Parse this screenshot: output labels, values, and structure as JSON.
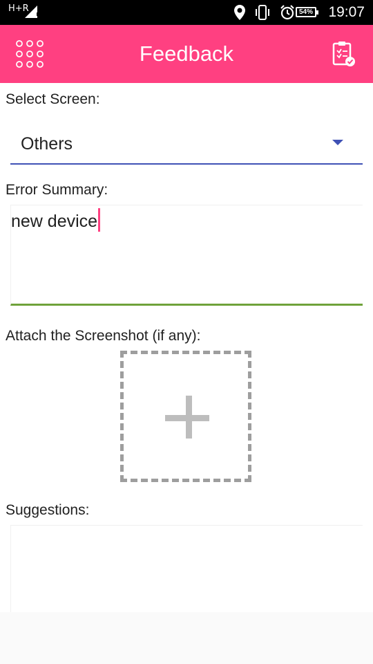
{
  "status_bar": {
    "network": "H+R",
    "battery": "54%",
    "time": "19:07",
    "icons": [
      "location-icon",
      "vibrate-icon",
      "alarm-icon"
    ]
  },
  "app_bar": {
    "title": "Feedback",
    "menu_icon": "grid-dots-icon",
    "action_icon": "clipboard-check-icon",
    "color": "#ff4081"
  },
  "form": {
    "select_screen_label": "Select Screen:",
    "selected_screen": "Others",
    "error_summary_label": "Error Summary:",
    "error_summary_value": "new device",
    "attach_label": "Attach the Screenshot (if any):",
    "suggestions_label": "Suggestions:",
    "suggestions_value": ""
  },
  "colors": {
    "accent": "#ff4081",
    "spinner_underline": "#3f51b5",
    "error_field_underline": "#6fa23a"
  }
}
